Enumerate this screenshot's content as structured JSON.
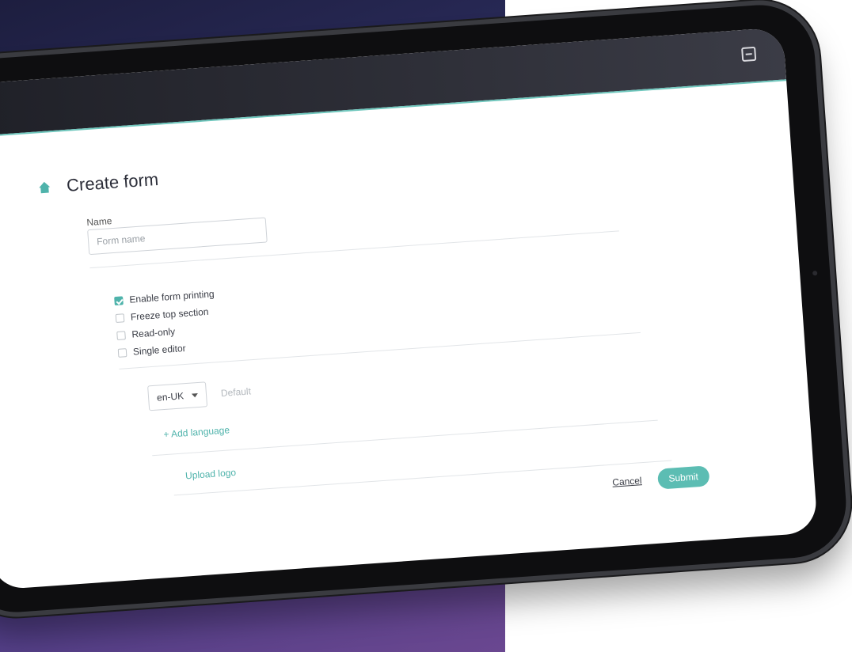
{
  "page": {
    "title": "Create form"
  },
  "form": {
    "name_label": "Name",
    "name_placeholder": "Form name",
    "options": [
      {
        "label": "Enable form printing",
        "checked": true
      },
      {
        "label": "Freeze top section",
        "checked": false
      },
      {
        "label": "Read-only",
        "checked": false
      },
      {
        "label": "Single editor",
        "checked": false
      }
    ],
    "language": {
      "selected": "en-UK",
      "default_text": "Default",
      "add_language": "+ Add language"
    },
    "upload_logo": "Upload logo"
  },
  "actions": {
    "cancel": "Cancel",
    "submit": "Submit"
  },
  "colors": {
    "accent": "#5cbdb3",
    "topbar": "#2f3039"
  },
  "icons": {
    "home": "home-icon",
    "topbar": "exit-icon"
  }
}
